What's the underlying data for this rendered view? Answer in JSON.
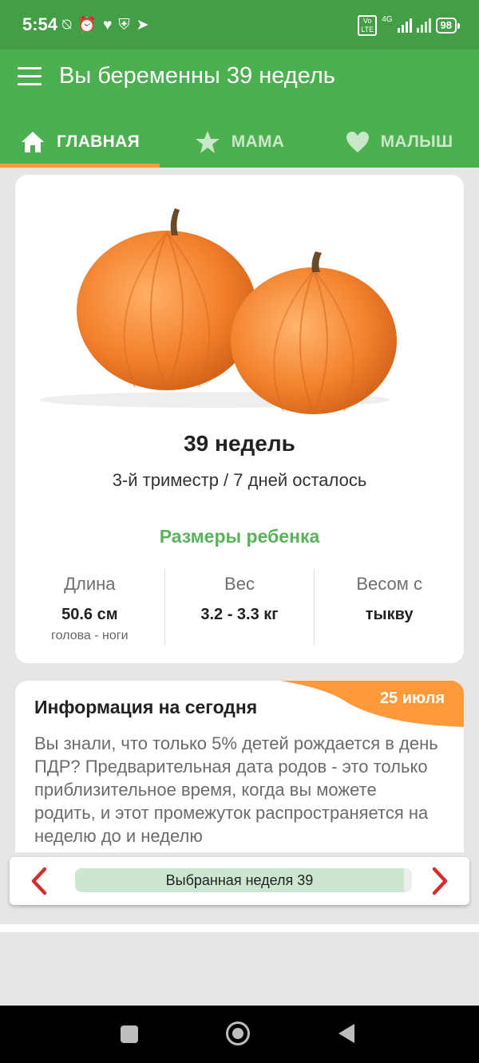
{
  "status_bar": {
    "time": "5:54",
    "network": "4G",
    "volte": "Vo LTE",
    "battery": "98",
    "icons": [
      "no-alarm-icon",
      "alarm-icon",
      "heart-icon",
      "shield-icon",
      "telegram-icon"
    ]
  },
  "app_bar": {
    "title": "Вы беременны 39 недель",
    "tabs": [
      {
        "label": "ГЛАВНАЯ",
        "icon": "home-icon",
        "active": true
      },
      {
        "label": "МАМА",
        "icon": "star-icon",
        "active": false
      },
      {
        "label": "МАЛЫШ",
        "icon": "heart-icon",
        "active": false
      }
    ]
  },
  "week_card": {
    "image": "pumpkins",
    "title": "39 недель",
    "subtitle": "3-й триместр / 7 дней осталось",
    "sizes_title": "Размеры ребенка",
    "stats": [
      {
        "label": "Длина",
        "value": "50.6 см",
        "sub": "голова - ноги"
      },
      {
        "label": "Вес",
        "value": "3.2 - 3.3 кг",
        "sub": ""
      },
      {
        "label": "Весом с",
        "value": "тыкву",
        "sub": ""
      }
    ]
  },
  "info_card": {
    "title": "Информация на сегодня",
    "date": "25 июля",
    "text": "Вы знали, что только 5% детей рождается в день ПДР? Предварительная дата родов - это только приблизительное время, когда вы можете родить, и этот промежуток распространяется на неделю до и неделю"
  },
  "week_selector": {
    "label": "Выбранная неделя 39",
    "progress": 0.985
  },
  "colors": {
    "status_bar": "#449e45",
    "app_bar": "#4caf50",
    "accent_orange": "#ff9a3c",
    "sizes_title": "#5bb15e",
    "arrow_red": "#d32f2f"
  }
}
